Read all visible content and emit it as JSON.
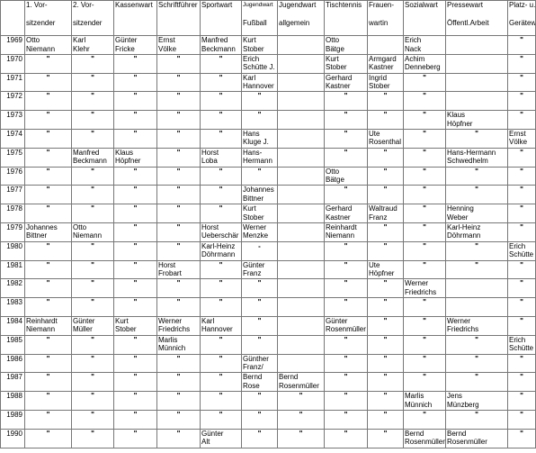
{
  "headers": [
    {
      "key": "year",
      "l1": "",
      "l2": ""
    },
    {
      "key": "v1",
      "l1": "1. Vor-",
      "l2": "sitzender"
    },
    {
      "key": "v2",
      "l1": "2. Vor-",
      "l2": "sitzender"
    },
    {
      "key": "kasse",
      "l1": "Kassenwart",
      "l2": ""
    },
    {
      "key": "schrift",
      "l1": "Schriftführer",
      "l2": ""
    },
    {
      "key": "sport",
      "l1": "Sportwart",
      "l2": ""
    },
    {
      "key": "jugendf",
      "l1": "Jugendwart",
      "l2": "Fußball"
    },
    {
      "key": "jugenda",
      "l1": "Jugendwart",
      "l2": "allgemein"
    },
    {
      "key": "tt",
      "l1": "Tischtennis",
      "l2": ""
    },
    {
      "key": "frauen",
      "l1": "Frauen-",
      "l2": "wartin"
    },
    {
      "key": "sozial",
      "l1": "Sozialwart",
      "l2": ""
    },
    {
      "key": "presse",
      "l1": "Pressewart",
      "l2": "Öffentl.Arbeit"
    },
    {
      "key": "platz",
      "l1": "Platz- u.",
      "l2": "Gerätewar t"
    }
  ],
  "rows": [
    {
      "year": "1969",
      "cells": [
        "Otto\nNiemann",
        "Karl\nKlehr",
        "Günter\nFricke",
        "Ernst\nVölke",
        "Manfred\nBeckmann",
        "Kurt\nStober",
        "",
        "Otto\nBätge",
        "",
        "Erich\nNack",
        "",
        "\""
      ]
    },
    {
      "year": "1970",
      "cells": [
        "\"",
        "\"",
        "\"",
        "\"",
        "\"",
        "Erich\nSchütte J.",
        "",
        "Kurt\nStober",
        "Armgard\nKastner",
        "Achim\nDenneberg",
        "",
        "\""
      ]
    },
    {
      "year": "1971",
      "cells": [
        "\"",
        "\"",
        "\"",
        "\"",
        "\"",
        "Karl\nHannover",
        "",
        "Gerhard\nKastner",
        "Ingrid\nStober",
        "\"",
        "",
        "\""
      ]
    },
    {
      "year": "1972",
      "cells": [
        "\"",
        "\"",
        "\"",
        "\"",
        "\"",
        "\"",
        "",
        "\"",
        "\"",
        "\"",
        "",
        "\""
      ]
    },
    {
      "year": "1973",
      "cells": [
        "\"",
        "\"",
        "\"",
        "\"",
        "\"",
        "\"",
        "",
        "\"",
        "\"",
        "\"",
        "Klaus\nHöpfner",
        "\""
      ]
    },
    {
      "year": "1974",
      "cells": [
        "\"",
        "\"",
        "\"",
        "\"",
        "\"",
        "Hans\nKluge J.",
        "",
        "\"",
        "Ute\nRosenthal",
        "\"",
        "\"",
        "Ernst\nVölke"
      ]
    },
    {
      "year": "1975",
      "cells": [
        "\"",
        "Manfred\nBeckmann",
        "Klaus\nHöpfner",
        "\"",
        "Horst\nLoba",
        "Hans-\nHermann",
        "",
        "\"",
        "\"",
        "\"",
        "Hans-Hermann\nSchwedhelm",
        "\""
      ]
    },
    {
      "year": "1976",
      "cells": [
        "\"",
        "\"",
        "\"",
        "\"",
        "\"",
        "\"",
        "",
        "Otto\nBätge",
        "\"",
        "\"",
        "\"",
        "\""
      ]
    },
    {
      "year": "1977",
      "cells": [
        "\"",
        "\"",
        "\"",
        "\"",
        "\"",
        "Johannes\nBittner",
        "",
        "\"",
        "\"",
        "\"",
        "\"",
        "\""
      ]
    },
    {
      "year": "1978",
      "cells": [
        "\"",
        "\"",
        "\"",
        "\"",
        "\"",
        "Kurt\nStober",
        "",
        "Gerhard\nKastner",
        "Waltraud\nFranz",
        "\"",
        "Henning\nWeber",
        "\""
      ]
    },
    {
      "year": "1979",
      "cells": [
        "Johannes\nBittner",
        "Otto\nNiemann",
        "\"",
        "\"",
        "Horst\nUeberschär",
        "Werner\nMenzke",
        "",
        "Reinhardt\nNiemann",
        "\"",
        "\"",
        "Karl-Heinz\nDöhrmann",
        "\""
      ]
    },
    {
      "year": "1980",
      "cells": [
        "\"",
        "\"",
        "\"",
        "\"",
        "Karl-Heinz\nDöhrmann",
        "-",
        "",
        "\"",
        "\"",
        "\"",
        "\"",
        "Erich\nSchütte J."
      ]
    },
    {
      "year": "1981",
      "cells": [
        "\"",
        "\"",
        "\"",
        "Horst\nFrobart",
        "\"",
        "Günter\nFranz",
        "",
        "\"",
        "Ute\nHöpfner",
        "\"",
        "\"",
        "\""
      ]
    },
    {
      "year": "1982",
      "cells": [
        "\"",
        "\"",
        "\"",
        "\"",
        "\"",
        "\"",
        "",
        "\"",
        "\"",
        "Werner\nFriedrichs",
        "",
        "\""
      ]
    },
    {
      "year": "1983",
      "cells": [
        "\"",
        "\"",
        "\"",
        "\"",
        "\"",
        "\"",
        "",
        "\"",
        "\"",
        "\"",
        "",
        "\""
      ]
    },
    {
      "year": "1984",
      "cells": [
        "Reinhardt\nNiemann",
        "Günter\nMüller",
        "Kurt\nStober",
        "Werner\nFriedrichs",
        "Karl\nHannover",
        "\"",
        "",
        "Günter\nRosenmüller",
        "\"",
        "\"",
        "Werner\nFriedrichs",
        "\""
      ]
    },
    {
      "year": "1985",
      "cells": [
        "\"",
        "\"",
        "\"",
        "Marlis\nMünnich",
        "\"",
        "\"",
        "",
        "\"",
        "\"",
        "\"",
        "\"",
        "Erich\nSchütte j."
      ]
    },
    {
      "year": "1986",
      "cells": [
        "\"",
        "\"",
        "\"",
        "\"",
        "\"",
        "Günther\nFranz/",
        "",
        "\"",
        "\"",
        "\"",
        "\"",
        "\""
      ]
    },
    {
      "year": "1987",
      "cells": [
        "\"",
        "\"",
        "\"",
        "\"",
        "\"",
        "Bernd\nRose",
        "Bernd\nRosenmüller",
        "\"",
        "\"",
        "\"",
        "\"",
        "\""
      ]
    },
    {
      "year": "1988",
      "cells": [
        "\"",
        "\"",
        "\"",
        "\"",
        "\"",
        "\"",
        "\"",
        "\"",
        "\"",
        "Marlis\nMünnich",
        "Jens\nMünzberg",
        "\""
      ]
    },
    {
      "year": "1989",
      "cells": [
        "\"",
        "\"",
        "\"",
        "\"",
        "\"",
        "\"",
        "\"",
        "\"",
        "\"",
        "\"",
        "\"",
        "\""
      ]
    },
    {
      "year": "1990",
      "cells": [
        "\"",
        "\"",
        "\"",
        "\"",
        "Günter\nAlt",
        "\"",
        "\"",
        "\"",
        "\"",
        "Bernd\nRosenmüller",
        "Bernd\nRosenmüller",
        "\""
      ]
    }
  ]
}
